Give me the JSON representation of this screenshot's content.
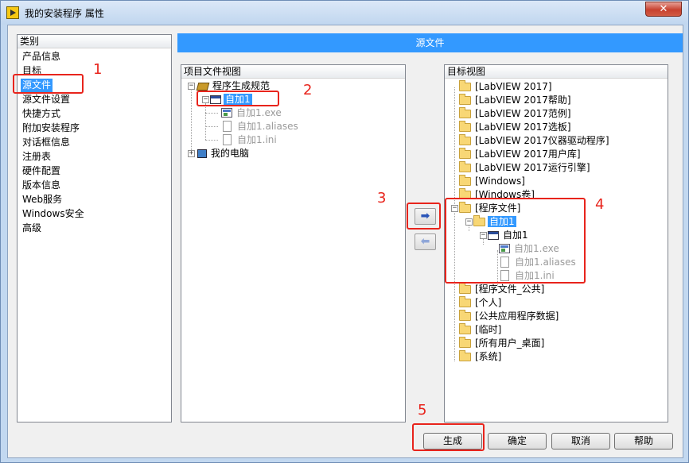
{
  "window": {
    "title": "我的安装程序 属性",
    "close_label": "✕"
  },
  "category": {
    "header": "类别",
    "items": [
      "产品信息",
      "目标",
      "源文件",
      "源文件设置",
      "快捷方式",
      "附加安装程序",
      "对话框信息",
      "注册表",
      "硬件配置",
      "版本信息",
      "Web服务",
      "Windows安全",
      "高级"
    ],
    "selected_index": 2
  },
  "section_title": "源文件",
  "project_view": {
    "header": "项目文件视图",
    "nodes": [
      {
        "label": "程序生成规范",
        "icon": "build-spec-icon",
        "expander": "−"
      },
      {
        "label": "自加1",
        "icon": "app-window-icon",
        "expander": "−",
        "selected": true
      },
      {
        "label": "自加1.exe",
        "icon": "exe-icon",
        "dim": true
      },
      {
        "label": "自加1.aliases",
        "icon": "file-icon",
        "dim": true
      },
      {
        "label": "自加1.ini",
        "icon": "file-icon",
        "dim": true
      },
      {
        "label": "我的电脑",
        "icon": "computer-icon",
        "expander": "+"
      }
    ]
  },
  "move_buttons": {
    "add": "➡",
    "remove": "⬅"
  },
  "target_view": {
    "header": "目标视图",
    "nodes": [
      {
        "label": "[LabVIEW 2017]"
      },
      {
        "label": "[LabVIEW 2017帮助]"
      },
      {
        "label": "[LabVIEW 2017范例]"
      },
      {
        "label": "[LabVIEW 2017选板]"
      },
      {
        "label": "[LabVIEW 2017仪器驱动程序]"
      },
      {
        "label": "[LabVIEW 2017用户库]"
      },
      {
        "label": "[LabVIEW 2017运行引擎]"
      },
      {
        "label": "[Windows]"
      },
      {
        "label": "[Windows卷]"
      },
      {
        "label": "[程序文件]"
      },
      {
        "label": "自加1"
      },
      {
        "label": "自加1"
      },
      {
        "label": "自加1.exe"
      },
      {
        "label": "自加1.aliases"
      },
      {
        "label": "自加1.ini"
      },
      {
        "label": "[程序文件_公共]"
      },
      {
        "label": "[个人]"
      },
      {
        "label": "[公共应用程序数据]"
      },
      {
        "label": "[临时]"
      },
      {
        "label": "[所有用户_桌面]"
      },
      {
        "label": "[系统]"
      }
    ]
  },
  "buttons": {
    "build": "生成",
    "ok": "确定",
    "cancel": "取消",
    "help": "帮助"
  },
  "annotations": [
    "1",
    "2",
    "3",
    "4",
    "5"
  ]
}
